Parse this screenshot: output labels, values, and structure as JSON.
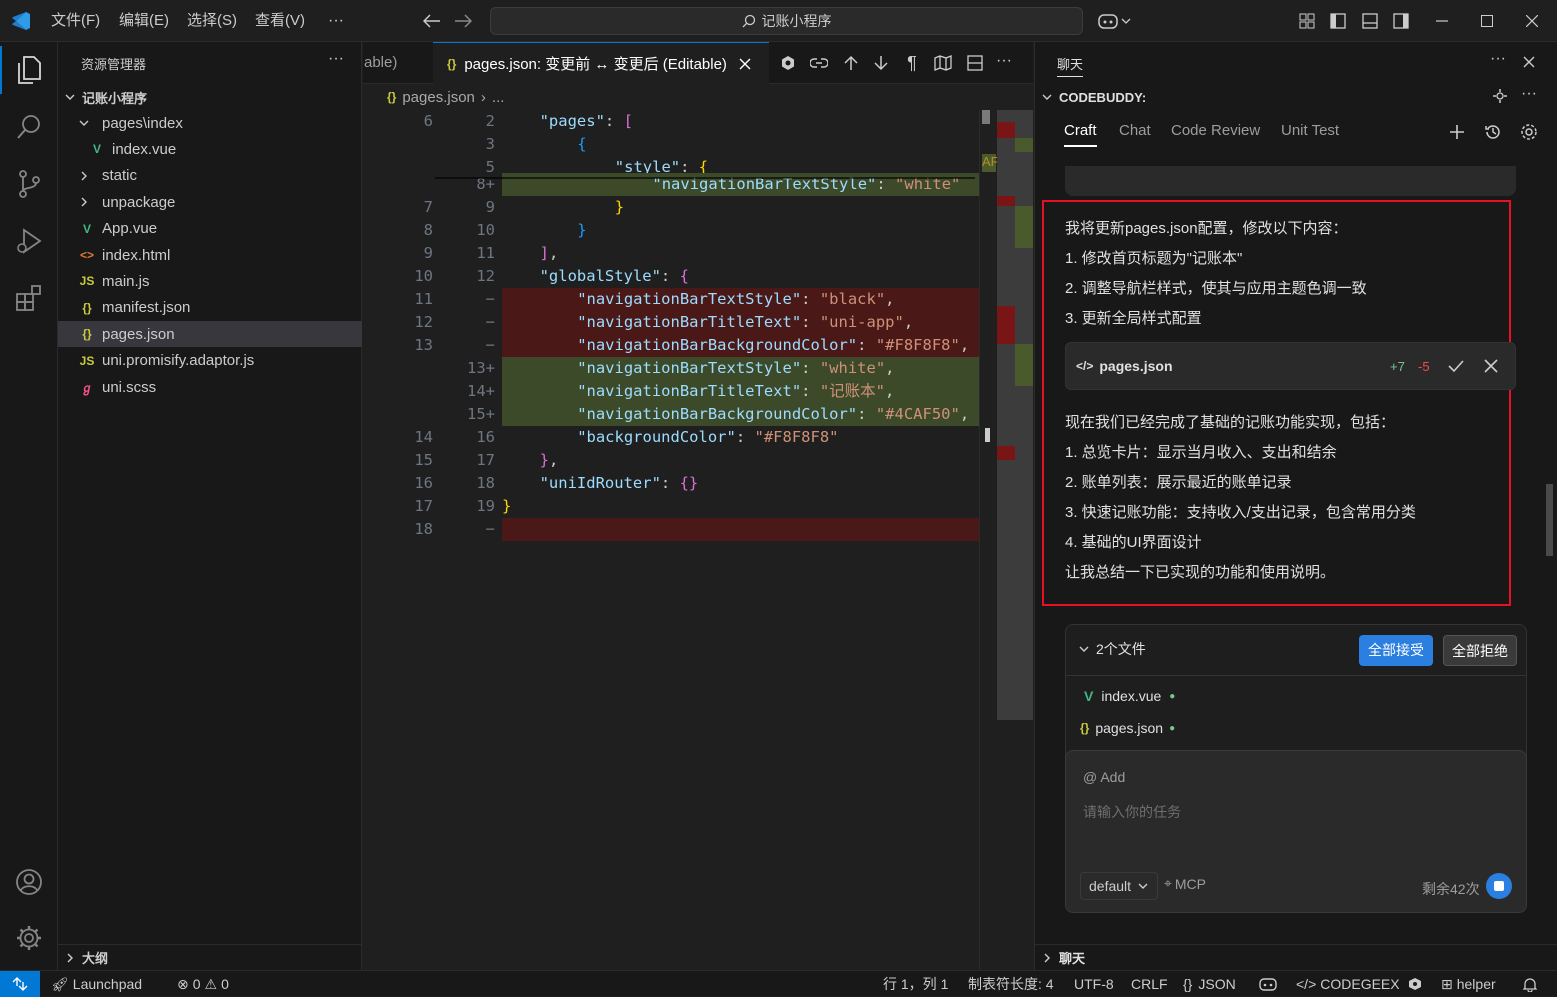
{
  "title_bar": {
    "menus": [
      "文件(F)",
      "编辑(E)",
      "选择(S)",
      "查看(V)"
    ],
    "more": "···",
    "search_text": "记账小程序"
  },
  "explorer": {
    "header": "资源管理器",
    "more": "···",
    "root": "记账小程序",
    "items": [
      {
        "label": "pages\\index",
        "type": "folder-open",
        "glyph": "",
        "color": ""
      },
      {
        "label": "index.vue",
        "type": "vue",
        "glyph": "V",
        "color": "#41b883"
      },
      {
        "label": "static",
        "type": "folder",
        "glyph": "",
        "color": ""
      },
      {
        "label": "unpackage",
        "type": "folder",
        "glyph": "",
        "color": ""
      },
      {
        "label": "App.vue",
        "type": "vue",
        "glyph": "V",
        "color": "#41b883"
      },
      {
        "label": "index.html",
        "type": "html",
        "glyph": "<>",
        "color": "#e37933"
      },
      {
        "label": "main.js",
        "type": "js",
        "glyph": "JS",
        "color": "#cbcb41"
      },
      {
        "label": "manifest.json",
        "type": "json",
        "glyph": "{}",
        "color": "#cbcb41"
      },
      {
        "label": "pages.json",
        "type": "json",
        "glyph": "{}",
        "color": "#cbcb41"
      },
      {
        "label": "uni.promisify.adaptor.js",
        "type": "js",
        "glyph": "JS",
        "color": "#cbcb41"
      },
      {
        "label": "uni.scss",
        "type": "scss",
        "glyph": "ℊ",
        "color": "#f55385"
      }
    ],
    "outline": "大纲"
  },
  "editor": {
    "prev_tab_fragment": "able)",
    "active_tab": "pages.json: 变更前 ↔ 变更后 (Editable)",
    "breadcrumb": [
      "pages.json",
      "..."
    ],
    "minimap_marker": "AF",
    "lines": [
      {
        "l": "6",
        "r": "2",
        "kind": "ctx",
        "segs": [
          [
            "k",
            "\"pages\""
          ],
          [
            "p",
            ": "
          ],
          [
            "b2",
            "["
          ]
        ],
        "indent": 4
      },
      {
        "l": "",
        "r": "3",
        "kind": "ctx",
        "segs": [
          [
            "b3",
            "{"
          ]
        ],
        "indent": 8
      },
      {
        "l": "",
        "r": "5",
        "kind": "ctx",
        "segs": [
          [
            "k",
            "\"style\""
          ],
          [
            "p",
            ": "
          ],
          [
            "b1",
            "{"
          ]
        ],
        "indent": 12
      },
      {
        "l": "",
        "r": "8+",
        "kind": "add",
        "segs": [
          [
            "k",
            "\"navigationBarTextStyle\""
          ],
          [
            "p",
            ": "
          ],
          [
            "s",
            "\"white\""
          ]
        ],
        "indent": 16
      },
      {
        "l": "7",
        "r": "9",
        "kind": "ctx",
        "segs": [
          [
            "b1",
            "}"
          ]
        ],
        "indent": 12
      },
      {
        "l": "8",
        "r": "10",
        "kind": "ctx",
        "segs": [
          [
            "b3",
            "}"
          ]
        ],
        "indent": 8
      },
      {
        "l": "9",
        "r": "11",
        "kind": "ctx",
        "segs": [
          [
            "b2",
            "]"
          ],
          [
            "p",
            ","
          ]
        ],
        "indent": 4
      },
      {
        "l": "10",
        "r": "12",
        "kind": "ctx",
        "segs": [
          [
            "k",
            "\"globalStyle\""
          ],
          [
            "p",
            ": "
          ],
          [
            "b2",
            "{"
          ]
        ],
        "indent": 4
      },
      {
        "l": "11",
        "r": "−",
        "kind": "del",
        "segs": [
          [
            "k",
            "\"navigationBarTextStyle\""
          ],
          [
            "p",
            ": "
          ],
          [
            "s",
            "\"black\""
          ],
          [
            "p",
            ","
          ]
        ],
        "indent": 8
      },
      {
        "l": "12",
        "r": "−",
        "kind": "del",
        "segs": [
          [
            "k",
            "\"navigationBarTitleText\""
          ],
          [
            "p",
            ": "
          ],
          [
            "s",
            "\"uni-app\""
          ],
          [
            "p",
            ","
          ]
        ],
        "indent": 8
      },
      {
        "l": "13",
        "r": "−",
        "kind": "del",
        "segs": [
          [
            "k",
            "\"navigationBarBackgroundColor\""
          ],
          [
            "p",
            ": "
          ],
          [
            "s",
            "\"#F8F8F8\""
          ],
          [
            "p",
            ","
          ]
        ],
        "indent": 8
      },
      {
        "l": "",
        "r": "13+",
        "kind": "add",
        "segs": [
          [
            "k",
            "\"navigationBarTextStyle\""
          ],
          [
            "p",
            ": "
          ],
          [
            "s",
            "\"white\""
          ],
          [
            "p",
            ","
          ]
        ],
        "indent": 8
      },
      {
        "l": "",
        "r": "14+",
        "kind": "add",
        "segs": [
          [
            "k",
            "\"navigationBarTitleText\""
          ],
          [
            "p",
            ": "
          ],
          [
            "s",
            "\"记账本\""
          ],
          [
            "p",
            ","
          ]
        ],
        "indent": 8
      },
      {
        "l": "",
        "r": "15+",
        "kind": "add",
        "segs": [
          [
            "k",
            "\"navigationBarBackgroundColor\""
          ],
          [
            "p",
            ": "
          ],
          [
            "s",
            "\"#4CAF50\""
          ],
          [
            "p",
            ","
          ]
        ],
        "indent": 8
      },
      {
        "l": "14",
        "r": "16",
        "kind": "ctx",
        "segs": [
          [
            "k",
            "\"backgroundColor\""
          ],
          [
            "p",
            ": "
          ],
          [
            "s",
            "\"#F8F8F8\""
          ]
        ],
        "indent": 8
      },
      {
        "l": "15",
        "r": "17",
        "kind": "ctx",
        "segs": [
          [
            "b2",
            "}"
          ],
          [
            "p",
            ","
          ]
        ],
        "indent": 4
      },
      {
        "l": "16",
        "r": "18",
        "kind": "ctx",
        "segs": [
          [
            "k",
            "\"uniIdRouter\""
          ],
          [
            "p",
            ": "
          ],
          [
            "b2",
            "{}"
          ]
        ],
        "indent": 4
      },
      {
        "l": "17",
        "r": "19",
        "kind": "ctx",
        "segs": [
          [
            "b1",
            "}"
          ]
        ],
        "indent": 0
      },
      {
        "l": "18",
        "r": "−",
        "kind": "del",
        "segs": [],
        "indent": 0
      }
    ]
  },
  "chat": {
    "header": "聊天",
    "section": "CODEBUDDY:",
    "tabs": [
      "Craft",
      "Chat",
      "Code Review",
      "Unit Test"
    ],
    "active_tab": "Craft",
    "message1": [
      "我将更新pages.json配置，修改以下内容：",
      "1. 修改首页标题为\"记账本\"",
      "2. 调整导航栏样式，使其与应用主题色调一致",
      "3. 更新全局样式配置"
    ],
    "file_card": {
      "name": "pages.json",
      "added": "+7",
      "removed": "-5"
    },
    "message2": [
      "现在我们已经完成了基础的记账功能实现，包括：",
      "1. 总览卡片：显示当月收入、支出和结余",
      "2. 账单列表：展示最近的账单记录",
      "3. 快速记账功能：支持收入/支出记录，包含常用分类",
      "4. 基础的UI界面设计",
      "让我总结一下已实现的功能和使用说明。"
    ],
    "changes": {
      "title": "2个文件",
      "accept_all": "全部接受",
      "reject_all": "全部拒绝",
      "files": [
        "index.vue",
        "pages.json"
      ]
    },
    "input": {
      "add": "@ Add",
      "placeholder": "请输入你的任务",
      "mode": "default",
      "mcp": "MCP",
      "remaining": "剩余42次"
    },
    "footer": "聊天"
  },
  "status_bar": {
    "launchpad": "Launchpad",
    "errors": "0",
    "warnings": "0",
    "position": "行 1，列 1",
    "tab_size": "制表符长度: 4",
    "encoding": "UTF-8",
    "eol": "CRLF",
    "language": "JSON",
    "codegeex": "CODEGEEX",
    "helper": "helper"
  },
  "colors": {
    "accent": "#0078d4",
    "add_bg": "#3d4a2a",
    "del_bg": "#4b1818",
    "highlight_red": "#e81123",
    "primary_button": "#2b7fe0"
  }
}
